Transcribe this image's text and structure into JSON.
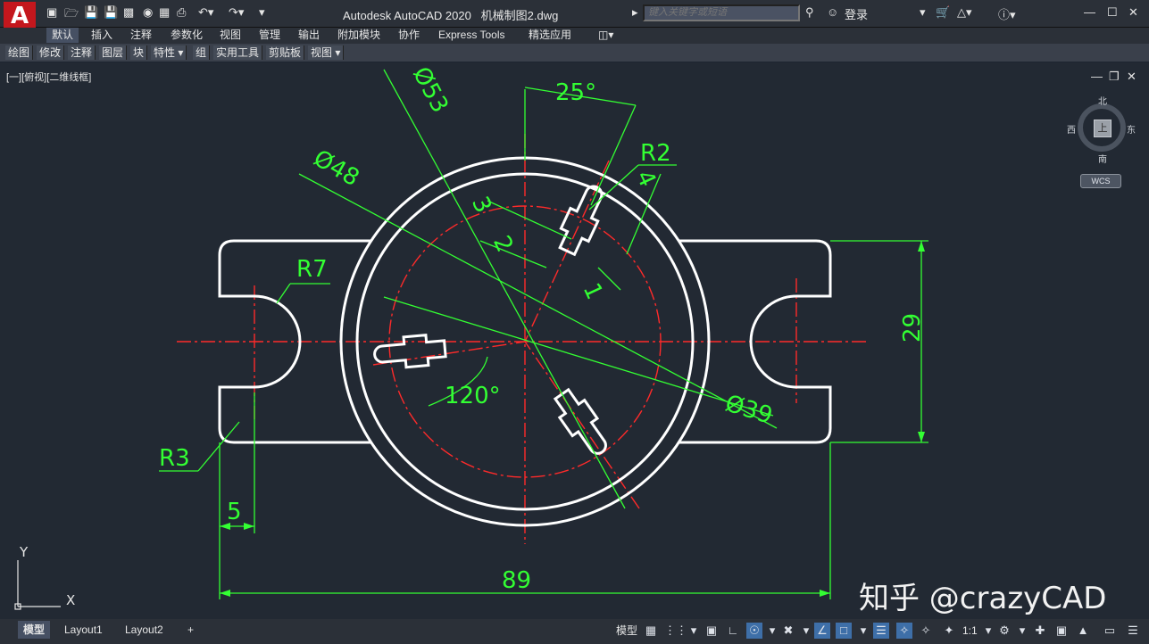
{
  "app": {
    "logo": "A",
    "title": "Autodesk AutoCAD 2020",
    "filename": "机械制图2.dwg"
  },
  "search": {
    "placeholder": "键入关键字或短语"
  },
  "account": {
    "login_label": "登录",
    "help_label": "?"
  },
  "ribbon_tabs": [
    "默认",
    "插入",
    "注释",
    "参数化",
    "视图",
    "管理",
    "输出",
    "附加模块",
    "协作",
    "Express Tools",
    "精选应用"
  ],
  "panels": [
    "绘图",
    "修改",
    "注释",
    "图层",
    "块",
    "特性",
    "组",
    "实用工具",
    "剪贴板",
    "视图"
  ],
  "viewport": {
    "label": "[一][俯视][二维线框]"
  },
  "viewcube": {
    "north": "北",
    "south": "南",
    "east": "东",
    "west": "西",
    "face": "上",
    "wcs": "WCS"
  },
  "drawing": {
    "dims": {
      "d53": "Ø53",
      "d48": "Ø48",
      "d39": "Ø39",
      "a25": "25°",
      "a120": "120°",
      "r2": "R2",
      "r7": "R7",
      "r3": "R3",
      "n4": "4",
      "n3": "3",
      "n2": "2",
      "n1": "1",
      "n29": "29",
      "n5": "5",
      "n89": "89"
    },
    "ucs": {
      "x": "X",
      "y": "Y"
    },
    "colors": {
      "outline": "#ffffff",
      "dimension": "#33ff33",
      "centerline": "#ff2a2a"
    }
  },
  "watermark": "知乎 @crazyCAD",
  "layout_tabs": {
    "model": "模型",
    "layout1": "Layout1",
    "layout2": "Layout2",
    "add": "+"
  },
  "status": {
    "model_label": "模型",
    "scale_label": "1:1"
  },
  "colors": {
    "background": "#222933",
    "chrome": "#2b3038",
    "logo_red": "#c4171d"
  }
}
